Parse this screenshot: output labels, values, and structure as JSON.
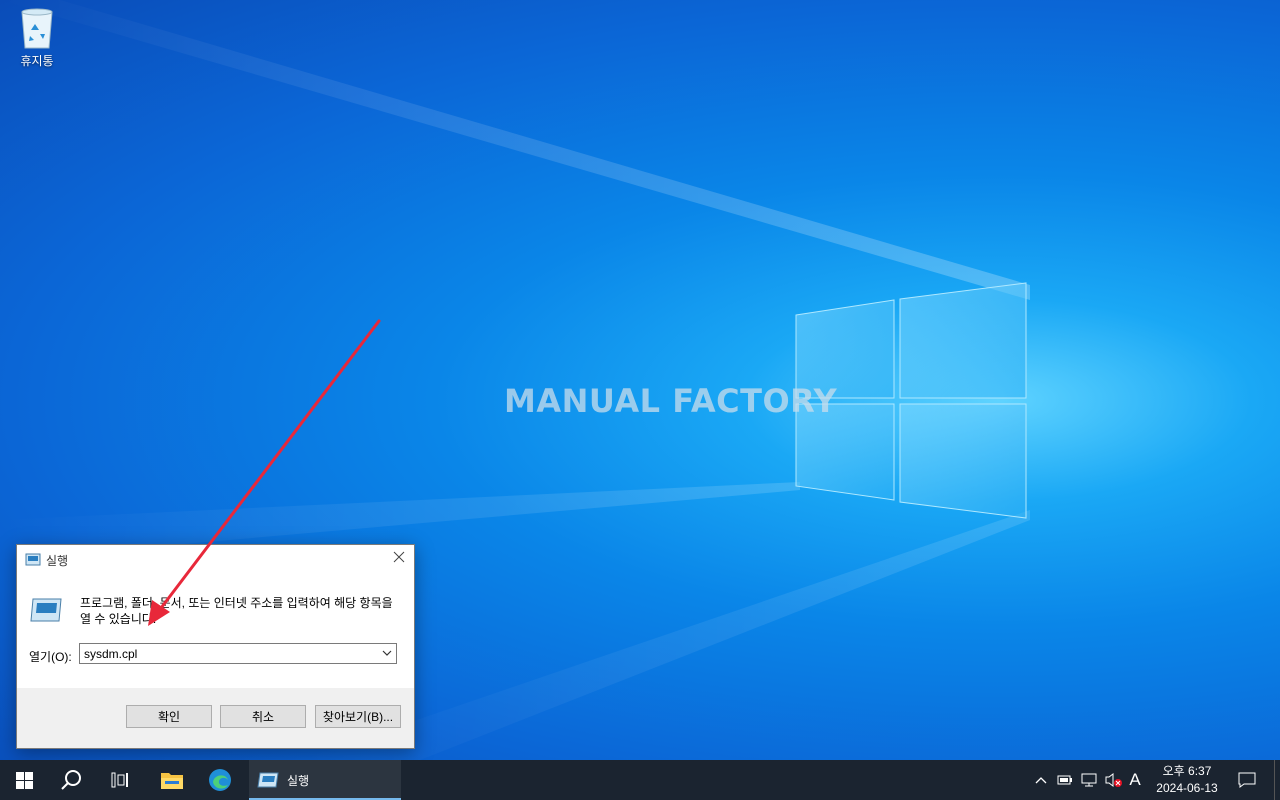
{
  "desktop": {
    "recycle_bin_label": "휴지통",
    "watermark": "MANUAL FACTORY"
  },
  "run_dialog": {
    "title": "실행",
    "description": "프로그램, 폴더, 문서, 또는 인터넷 주소를 입력하여 해당 항목을 열 수 있습니다.",
    "open_label": "열기(O):",
    "open_value": "sysdm.cpl",
    "ok_label": "확인",
    "cancel_label": "취소",
    "browse_label": "찾아보기(B)..."
  },
  "taskbar": {
    "run_label": "실행",
    "time": "오후 6:37",
    "date": "2024-06-13",
    "ime": "A"
  },
  "colors": {
    "taskbar_bg": "#1b2430",
    "arrow": "#e8283a",
    "desktop_accent": "#0a86e8"
  }
}
